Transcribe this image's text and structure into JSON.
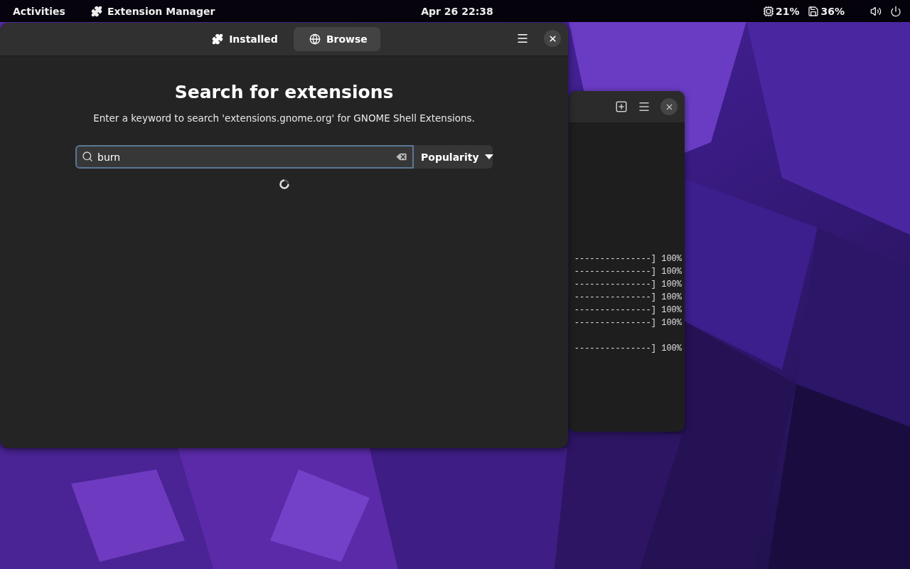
{
  "top_bar": {
    "activities": "Activities",
    "app_name": "Extension Manager",
    "clock": "Apr 26  22:38",
    "indicators": [
      {
        "kind": "chip",
        "text": "21%"
      },
      {
        "kind": "floppy",
        "text": "36%"
      }
    ]
  },
  "window": {
    "tabs": [
      {
        "label": "Installed",
        "kind": "puzzle",
        "selected": false
      },
      {
        "label": "Browse",
        "kind": "globe",
        "selected": true
      }
    ],
    "heading": "Search for extensions",
    "description": "Enter a keyword to search 'extensions.gnome.org' for GNOME Shell Extensions.",
    "search": {
      "value": "burn"
    },
    "sort": {
      "label": "Popularity"
    },
    "loading": true
  },
  "terminal": {
    "lines": [
      {
        "text": "---------------] 100%",
        "spaced": false
      },
      {
        "text": "---------------] 100%",
        "spaced": false
      },
      {
        "text": "---------------] 100%",
        "spaced": false
      },
      {
        "text": "---------------] 100%",
        "spaced": false
      },
      {
        "text": "---------------] 100%",
        "spaced": false
      },
      {
        "text": "---------------] 100%",
        "spaced": false
      },
      {
        "text": "---------------] 100%",
        "spaced": true
      }
    ]
  }
}
